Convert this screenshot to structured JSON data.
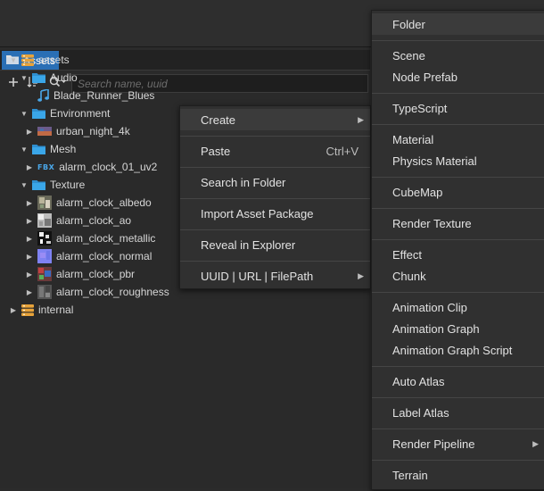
{
  "assets_tab": {
    "label": "Assets"
  },
  "search": {
    "placeholder": "Search name, uuid"
  },
  "tree": [
    {
      "label": "assets",
      "depth": 0,
      "expanded": true,
      "icon": "db-icon"
    },
    {
      "label": "Audio",
      "depth": 1,
      "expanded": true,
      "icon": "folder-icon"
    },
    {
      "label": "Blade_Runner_Blues",
      "depth": 2,
      "expanded": null,
      "icon": "music-icon"
    },
    {
      "label": "Environment",
      "depth": 1,
      "expanded": true,
      "icon": "folder-icon"
    },
    {
      "label": "urban_night_4k",
      "depth": 2,
      "expanded": false,
      "icon": "hdr-icon"
    },
    {
      "label": "Mesh",
      "depth": 1,
      "expanded": true,
      "icon": "folder-icon"
    },
    {
      "label": "alarm_clock_01_uv2",
      "depth": 2,
      "expanded": false,
      "icon": "fbx-icon"
    },
    {
      "label": "Texture",
      "depth": 1,
      "expanded": true,
      "icon": "folder-icon"
    },
    {
      "label": "alarm_clock_albedo",
      "depth": 2,
      "expanded": false,
      "icon": "texture-albedo-icon"
    },
    {
      "label": "alarm_clock_ao",
      "depth": 2,
      "expanded": false,
      "icon": "texture-ao-icon"
    },
    {
      "label": "alarm_clock_metallic",
      "depth": 2,
      "expanded": false,
      "icon": "texture-metallic-icon"
    },
    {
      "label": "alarm_clock_normal",
      "depth": 2,
      "expanded": false,
      "icon": "texture-normal-icon"
    },
    {
      "label": "alarm_clock_pbr",
      "depth": 2,
      "expanded": false,
      "icon": "texture-pbr-icon"
    },
    {
      "label": "alarm_clock_roughness",
      "depth": 2,
      "expanded": false,
      "icon": "texture-roughness-icon"
    },
    {
      "label": "internal",
      "depth": 0,
      "expanded": false,
      "icon": "db-icon"
    }
  ],
  "fbx_badge": "FBX",
  "context_menu": {
    "items": [
      {
        "label": "Create",
        "submenu": true,
        "shortcut": ""
      },
      {
        "label": "Paste",
        "submenu": false,
        "shortcut": "Ctrl+V"
      },
      {
        "label": "Search in Folder",
        "submenu": false,
        "shortcut": ""
      },
      {
        "label": "Import Asset Package",
        "submenu": false,
        "shortcut": ""
      },
      {
        "label": "Reveal in Explorer",
        "submenu": false,
        "shortcut": ""
      },
      {
        "label": "UUID | URL | FilePath",
        "submenu": true,
        "shortcut": ""
      }
    ]
  },
  "create_menu": {
    "items": [
      {
        "label": "Folder",
        "submenu": false
      },
      {
        "label": "Scene",
        "submenu": false
      },
      {
        "label": "Node Prefab",
        "submenu": false
      },
      {
        "label": "TypeScript",
        "submenu": false
      },
      {
        "label": "Material",
        "submenu": false
      },
      {
        "label": "Physics Material",
        "submenu": false
      },
      {
        "label": "CubeMap",
        "submenu": false
      },
      {
        "label": "Render Texture",
        "submenu": false
      },
      {
        "label": "Effect",
        "submenu": false
      },
      {
        "label": "Chunk",
        "submenu": false
      },
      {
        "label": "Animation Clip",
        "submenu": false
      },
      {
        "label": "Animation Graph",
        "submenu": false
      },
      {
        "label": "Animation Graph Script",
        "submenu": false
      },
      {
        "label": "Auto Atlas",
        "submenu": false
      },
      {
        "label": "Label Atlas",
        "submenu": false
      },
      {
        "label": "Render Pipeline",
        "submenu": true
      },
      {
        "label": "Terrain",
        "submenu": false
      }
    ]
  },
  "colors": {
    "accent": "#2a6fb5",
    "folder": "#3aa0e0",
    "database": "#e8a33a"
  }
}
